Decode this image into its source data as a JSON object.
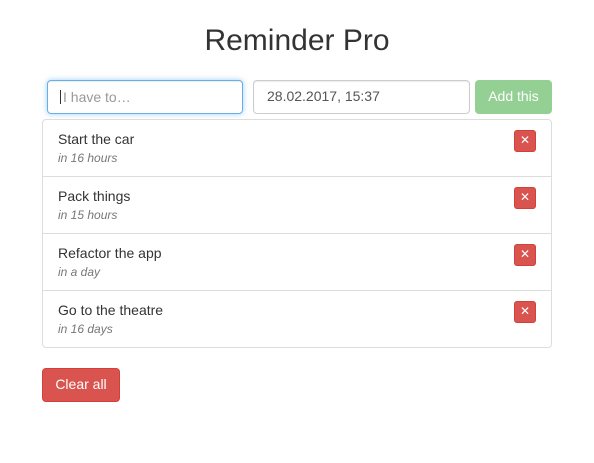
{
  "app": {
    "title": "Reminder Pro"
  },
  "form": {
    "todo_placeholder": "I have to…",
    "todo_value": "",
    "date_value": "28.02.2017, 15:37",
    "add_label": "Add this"
  },
  "reminders": [
    {
      "text": "Start the car",
      "due": "in 16 hours",
      "delete_label": "✕"
    },
    {
      "text": "Pack things",
      "due": "in 15 hours",
      "delete_label": "✕"
    },
    {
      "text": "Refactor the app",
      "due": "in a day",
      "delete_label": "✕"
    },
    {
      "text": "Go to the theatre",
      "due": "in 16 days",
      "delete_label": "✕"
    }
  ],
  "actions": {
    "clear_label": "Clear all"
  },
  "colors": {
    "focus_border": "#66afe9",
    "success": "#5cb85c",
    "danger": "#d9534f",
    "muted_text": "#777777"
  },
  "icons": {
    "delete": "close-icon"
  }
}
